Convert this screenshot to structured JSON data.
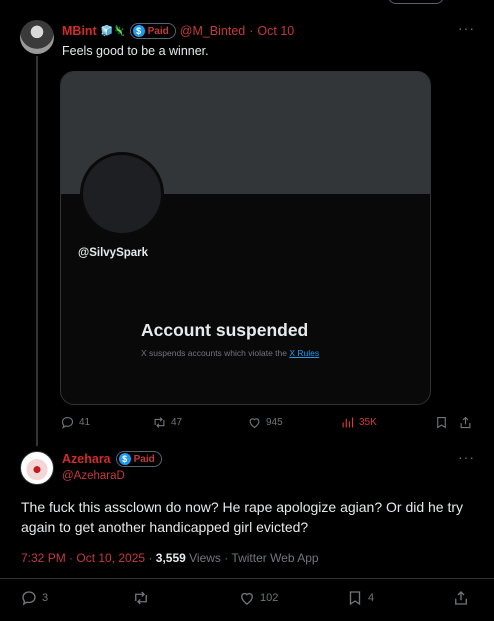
{
  "post1": {
    "display_name": "MBint",
    "emoji_badges": "🧊🦎",
    "paid_label": "Paid",
    "coin_symbol": "$",
    "handle": "@M_Binted",
    "separator": "·",
    "date": "Oct 10",
    "more": "···",
    "text": "Feels good to be a winner.",
    "card": {
      "handle": "@SilvySpark",
      "title": "Account suspended",
      "subtitle_prefix": "X suspends accounts which violate the ",
      "rules_link": "X Rules"
    },
    "actions": {
      "replies": "41",
      "reposts": "47",
      "likes": "945",
      "views": "35K"
    }
  },
  "post2": {
    "display_name": "Azehara",
    "paid_label": "Paid",
    "coin_symbol": "$",
    "handle": "@AzeharaD",
    "more": "···",
    "text": "The fuck this assclown do now?  He rape apologize agian?  Or did he try again to get another handicapped girl evicted?",
    "meta": {
      "time": "7:32 PM · Oct 10, 2025",
      "dot": "·",
      "views_count": "3,559",
      "views_label": "Views",
      "source": "· Twitter Web App"
    },
    "actions": {
      "replies": "3",
      "likes": "102",
      "bookmarks": "4"
    }
  },
  "colors": {
    "background": "#000000",
    "name_red": "#d22b2b",
    "link_blue": "#1d9bf0",
    "muted": "#71767b",
    "views_red": "#d63b3b"
  }
}
